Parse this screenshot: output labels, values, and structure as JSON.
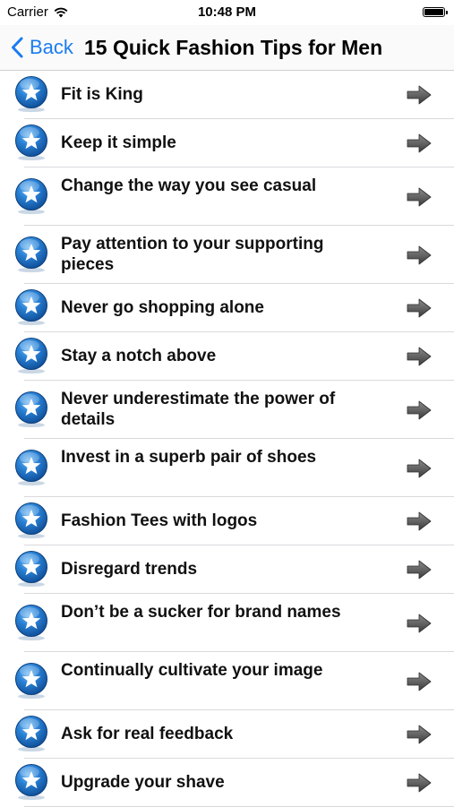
{
  "status_bar": {
    "carrier": "Carrier",
    "time": "10:48 PM",
    "icons": [
      "wifi-icon",
      "battery-icon"
    ]
  },
  "nav": {
    "back_label": "Back",
    "title": "15 Quick Fashion Tips for Men"
  },
  "items": [
    {
      "label": "Fit is King"
    },
    {
      "label": "Keep it simple"
    },
    {
      "label": "Change the way you see casual"
    },
    {
      "label": "Pay attention to your supporting pieces"
    },
    {
      "label": "Never go shopping alone"
    },
    {
      "label": "Stay a notch above"
    },
    {
      "label": "Never underestimate the power of details"
    },
    {
      "label": "Invest in a superb pair of shoes"
    },
    {
      "label": "Fashion Tees with logos"
    },
    {
      "label": "Disregard trends"
    },
    {
      "label": "Don’t be a sucker for brand names"
    },
    {
      "label": "Continually cultivate your image"
    },
    {
      "label": "Ask for real feedback"
    },
    {
      "label": "Upgrade your shave"
    }
  ],
  "colors": {
    "accent": "#1a7cf0",
    "star_badge": "#1f6fc4",
    "arrow": "#555555",
    "separator": "#d9d9dd"
  }
}
